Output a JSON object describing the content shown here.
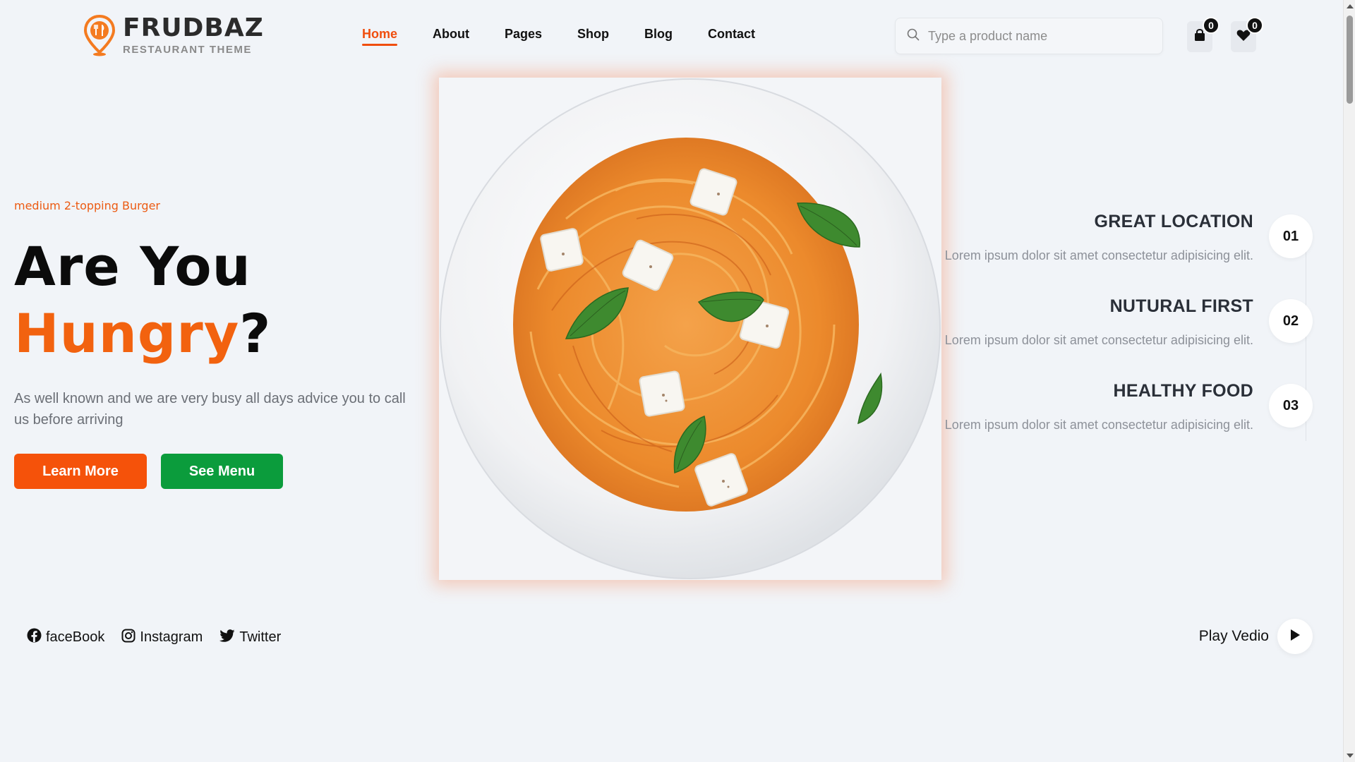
{
  "brand": {
    "name": "FRUDBAZ",
    "subtitle": "RESTAURANT THEME",
    "icon": "location-pin-cutlery-icon",
    "accent_color": "#f2620f"
  },
  "nav": {
    "items": [
      {
        "label": "Home",
        "active": true
      },
      {
        "label": "About",
        "active": false
      },
      {
        "label": "Pages",
        "active": false
      },
      {
        "label": "Shop",
        "active": false
      },
      {
        "label": "Blog",
        "active": false
      },
      {
        "label": "Contact",
        "active": false
      }
    ]
  },
  "search": {
    "placeholder": "Type a product name",
    "value": "",
    "icon": "search-icon"
  },
  "cart": {
    "count": "0",
    "icon": "shopping-bag-icon"
  },
  "wishlist": {
    "count": "0",
    "icon": "heart-icon"
  },
  "hero": {
    "tagline": "medium 2-topping Burger",
    "title_line1": "Are You",
    "title_accent": "Hungry",
    "title_suffix": "?",
    "description": "As well known and we are very busy all days advice you to call us before arriving",
    "learn_more_label": "Learn More",
    "see_menu_label": "See Menu",
    "learn_more_color": "#f5520a",
    "see_menu_color": "#0b9c3c",
    "image": "spaghetti-plate-image"
  },
  "features": [
    {
      "number": "01",
      "title": "GREAT LOCATION",
      "text": "Lorem ipsum dolor sit amet consectetur adipisicing elit."
    },
    {
      "number": "02",
      "title": "NUTURAL FIRST",
      "text": "Lorem ipsum dolor sit amet consectetur adipisicing elit."
    },
    {
      "number": "03",
      "title": "HEALTHY FOOD",
      "text": "Lorem ipsum dolor sit amet consectetur adipisicing elit."
    }
  ],
  "socials": [
    {
      "label": "faceBook",
      "icon": "facebook-icon"
    },
    {
      "label": "Instagram",
      "icon": "instagram-icon"
    },
    {
      "label": "Twitter",
      "icon": "twitter-icon"
    }
  ],
  "video": {
    "label": "Play Vedio",
    "icon": "play-icon"
  }
}
